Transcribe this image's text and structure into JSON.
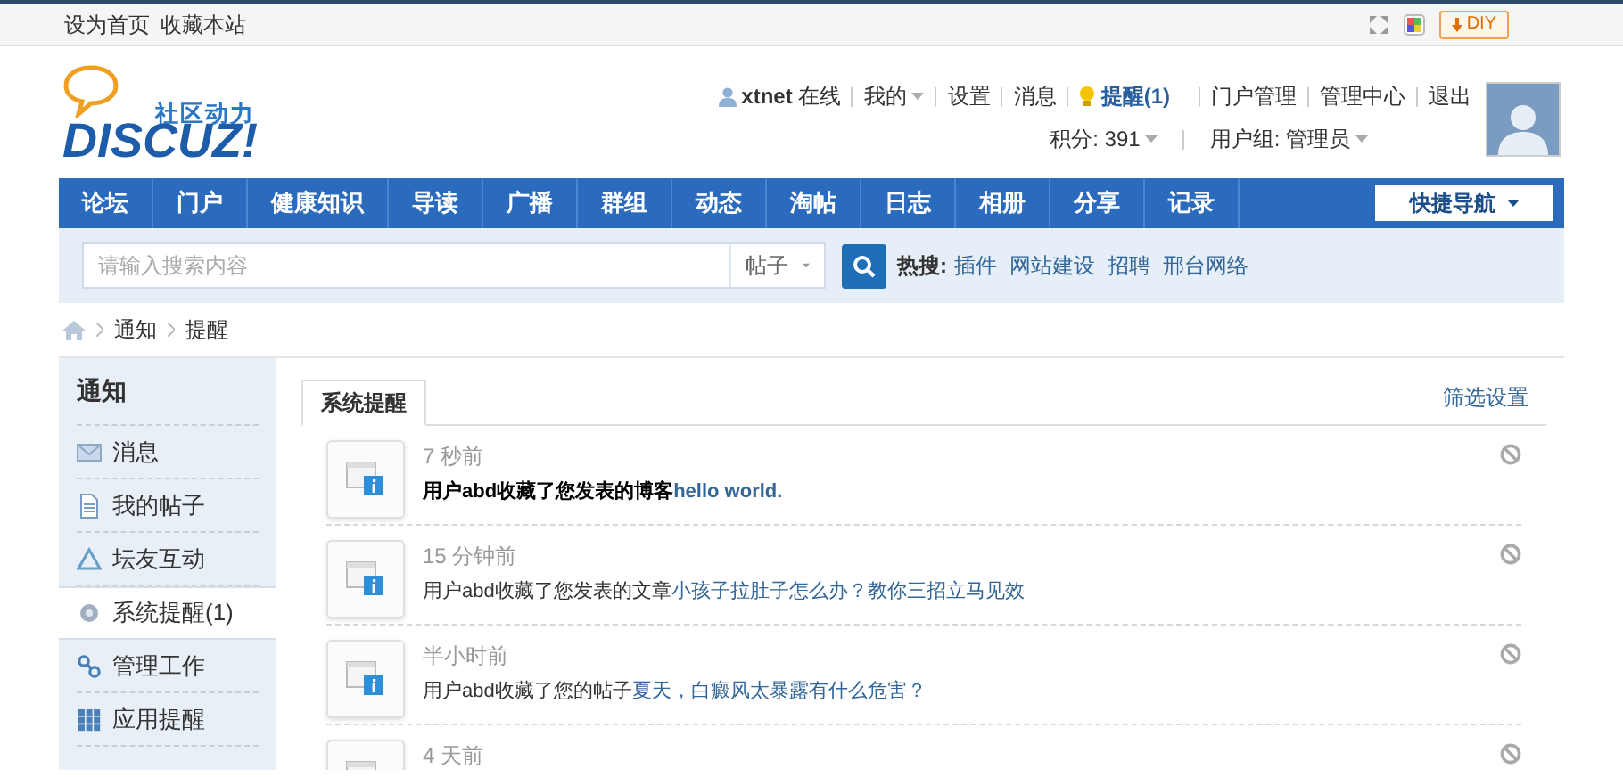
{
  "topbar": {
    "links": [
      "设为首页",
      "收藏本站"
    ],
    "diy_button": "DIY"
  },
  "logo": {
    "slogan": "社区动力",
    "wordmark": "DISCUZ!"
  },
  "user_bar": {
    "username": "xtnet",
    "status": "在线",
    "links": [
      {
        "label": "我的",
        "dropdown": true
      },
      {
        "label": "设置",
        "dropdown": false
      },
      {
        "label": "消息",
        "dropdown": false
      }
    ],
    "reminder": "提醒(1)",
    "admin_links": [
      "门户管理",
      "管理中心",
      "退出"
    ],
    "points": "积分: 391",
    "group": "用户组: 管理员"
  },
  "nav": {
    "items": [
      {
        "label": "论坛"
      },
      {
        "label": "门户"
      },
      {
        "label": "健康知识"
      },
      {
        "label": "导读"
      },
      {
        "label": "广播"
      },
      {
        "label": "群组"
      },
      {
        "label": "动态"
      },
      {
        "label": "淘帖"
      },
      {
        "label": "日志"
      },
      {
        "label": "相册"
      },
      {
        "label": "分享"
      },
      {
        "label": "记录"
      }
    ],
    "quick_nav": "快捷导航"
  },
  "search": {
    "placeholder": "请输入搜索内容",
    "scope": "帖子",
    "hot_label": "热搜:",
    "hot_links": [
      "插件",
      "网站建设",
      "招聘",
      "邢台网络"
    ]
  },
  "breadcrumb": [
    "通知",
    "提醒"
  ],
  "sidebar": {
    "title": "通知",
    "items": [
      {
        "label": "消息",
        "kind": "mail",
        "selected": false
      },
      {
        "label": "我的帖子",
        "kind": "doc",
        "selected": false
      },
      {
        "label": "坛友互动",
        "kind": "triangle",
        "selected": false
      },
      {
        "label": "系统提醒(1)",
        "kind": "gear",
        "selected": true
      },
      {
        "label": "管理工作",
        "kind": "link",
        "selected": false
      },
      {
        "label": "应用提醒",
        "kind": "grid",
        "selected": false
      }
    ]
  },
  "tabs": [
    {
      "label": "系统提醒",
      "selected": true
    }
  ],
  "filter_link": "筛选设置",
  "notices": [
    {
      "time": "7 秒前",
      "text": "用户abd收藏了您发表的博客",
      "link": "hello world.",
      "unread": true
    },
    {
      "time": "15 分钟前",
      "text": "用户abd收藏了您发表的文章",
      "link": "小孩子拉肚子怎么办？教你三招立马见效",
      "unread": false
    },
    {
      "time": "半小时前",
      "text": "用户abd收藏了您的帖子",
      "link": "夏天，白癜风太暴露有什么危害？",
      "unread": false
    },
    {
      "time": "4 天前"
    }
  ]
}
